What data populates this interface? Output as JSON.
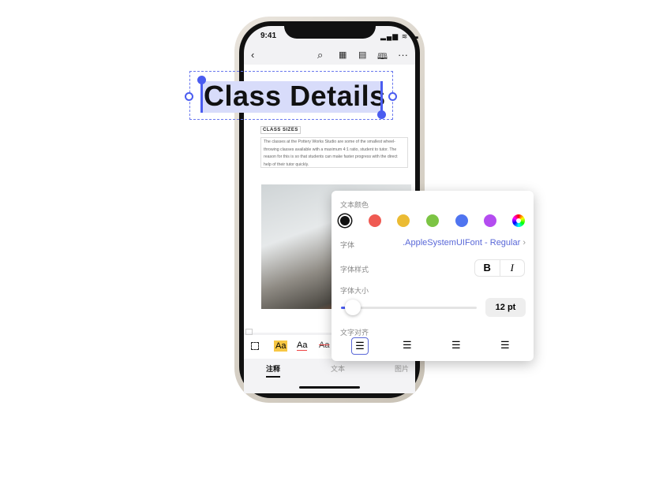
{
  "status": {
    "time": "9:41"
  },
  "toolbar": {
    "icons": [
      "back-icon",
      "search-icon",
      "grid-icon",
      "bookmark-icon",
      "book-icon",
      "more-icon"
    ]
  },
  "document": {
    "title": "Class Details",
    "section_label": "CLASS SIZES",
    "paragraph": "The classes at the Pottery Works Studio are some of the smallest wheel-throwing classes available with a maximum 4:1 ratio, student to tutor. The reason for this is so that students can make faster progress with the direct help of their tutor quickly."
  },
  "annot_tools": {
    "highlight": "Aa",
    "underline": "Aa",
    "strike": "Aa"
  },
  "tabs": [
    {
      "label": "注释",
      "active": true
    },
    {
      "label": "文本"
    },
    {
      "label": "图片"
    }
  ],
  "popup": {
    "color_label": "文本颜色",
    "colors": [
      "#111111",
      "#ef5a52",
      "#ebbb33",
      "#7cc444",
      "#4f74f0",
      "#b44cf0"
    ],
    "selected_color": "#111111",
    "font_label": "字体",
    "font_value": ".AppleSystemUIFont - Regular",
    "style_label": "字体样式",
    "bold": "B",
    "italic": "I",
    "size_label": "字体大小",
    "size_value": "12 pt",
    "size_slider_fraction": 0.05,
    "align_label": "文字对齐",
    "align_selected": "left",
    "accent": "#4a5cf0"
  }
}
